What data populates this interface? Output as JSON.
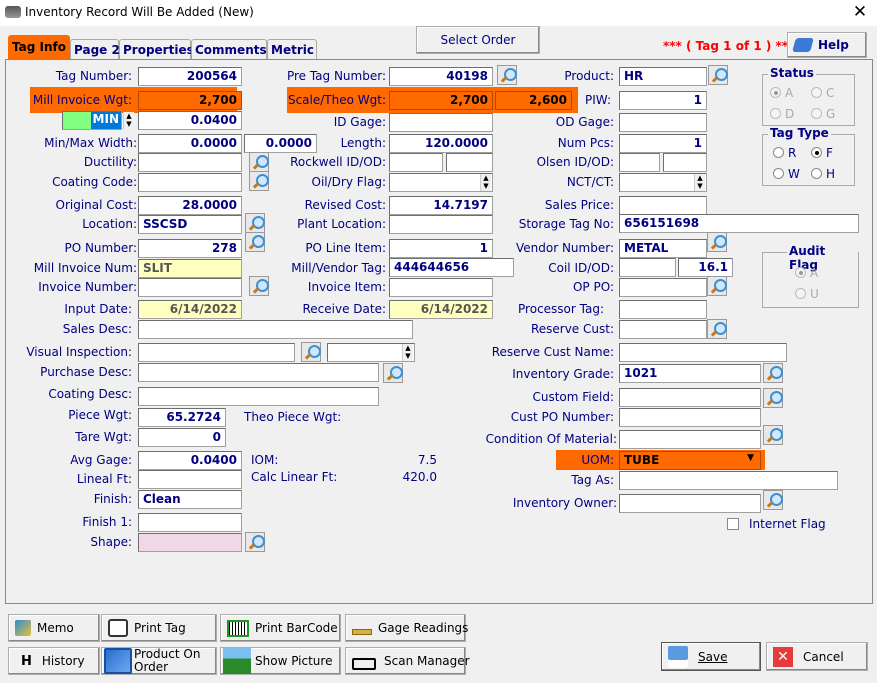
{
  "window": {
    "title": "Inventory Record Will Be Added  (New)",
    "close": "✕"
  },
  "tabs": [
    {
      "label": "Tag Info"
    },
    {
      "label": "Page 2"
    },
    {
      "label": "Properties"
    },
    {
      "label": "Comments"
    },
    {
      "label": "Metric"
    }
  ],
  "header": {
    "select_order": "Select Order",
    "tag_counter": "***   ( Tag 1 of 1 )   ***",
    "help": "Help"
  },
  "fields": {
    "tag_number": {
      "label": "Tag Number:",
      "value": "200564"
    },
    "mill_invoice_wgt": {
      "label": "Mill Invoice Wgt:",
      "value": "2,700"
    },
    "unit_select": {
      "value": "MIN"
    },
    "gage": {
      "value": "0.0400"
    },
    "min_max_width": {
      "label": "Min/Max Width:",
      "min": "0.0000",
      "max": "0.0000"
    },
    "ductility": {
      "label": "Ductility:",
      "value": ""
    },
    "coating_code": {
      "label": "Coating Code:",
      "value": ""
    },
    "original_cost": {
      "label": "Original Cost:",
      "value": "28.0000"
    },
    "location": {
      "label": "Location:",
      "value": "SSCSD"
    },
    "po_number": {
      "label": "PO Number:",
      "value": "278"
    },
    "mill_invoice_num": {
      "label": "Mill Invoice Num:",
      "value": "SLIT"
    },
    "invoice_number": {
      "label": "Invoice Number:",
      "value": ""
    },
    "input_date": {
      "label": "Input Date:",
      "value": "6/14/2022"
    },
    "sales_desc": {
      "label": "Sales Desc:",
      "value": ""
    },
    "visual_inspection": {
      "label": "Visual Inspection:",
      "value": "",
      "value2": ""
    },
    "purchase_desc": {
      "label": "Purchase Desc:",
      "value": ""
    },
    "coating_desc": {
      "label": "Coating Desc:",
      "value": ""
    },
    "piece_wgt": {
      "label": "Piece Wgt:",
      "value": "65.2724"
    },
    "theo_piece_wgt": {
      "label": "Theo Piece Wgt:"
    },
    "tare_wgt": {
      "label": "Tare Wgt:",
      "value": "0"
    },
    "avg_gage": {
      "label": "Avg Gage:",
      "value": "0.0400"
    },
    "lineal_ft": {
      "label": "Lineal Ft:",
      "value": ""
    },
    "finish": {
      "label": "Finish:",
      "value": "Clean"
    },
    "finish1": {
      "label": "Finish 1:",
      "value": ""
    },
    "shape": {
      "label": "Shape:",
      "value": ""
    },
    "iom": {
      "label": "IOM:",
      "value": "7.5"
    },
    "calc_linear_ft": {
      "label": "Calc Linear Ft:",
      "value": "420.0"
    },
    "pre_tag_number": {
      "label": "Pre Tag Number:",
      "value": "40198"
    },
    "scale_theo_wgt": {
      "label": "Scale/Theo Wgt:",
      "scale": "2,700",
      "theo": "2,600"
    },
    "id_gage": {
      "label": "ID Gage:",
      "value": ""
    },
    "length": {
      "label": "Length:",
      "value": "120.0000"
    },
    "rockwell": {
      "label": "Rockwell ID/OD:",
      "id": "",
      "od": ""
    },
    "oil_dry_flag": {
      "label": "Oil/Dry Flag:",
      "value": ""
    },
    "revised_cost": {
      "label": "Revised Cost:",
      "value": "14.7197"
    },
    "plant_location": {
      "label": "Plant Location:",
      "value": ""
    },
    "po_line_item": {
      "label": "PO Line Item:",
      "value": "1"
    },
    "mill_vendor_tag": {
      "label": "Mill/Vendor Tag:",
      "value": "444644656"
    },
    "invoice_item": {
      "label": "Invoice Item:",
      "value": ""
    },
    "receive_date": {
      "label": "Receive Date:",
      "value": "6/14/2022"
    },
    "product": {
      "label": "Product:",
      "value": "HR"
    },
    "piw": {
      "label": "PIW:",
      "value": "1"
    },
    "od_gage": {
      "label": "OD Gage:",
      "value": ""
    },
    "num_pcs": {
      "label": "Num Pcs:",
      "value": "1"
    },
    "olsen": {
      "label": "Olsen ID/OD:",
      "id": "",
      "od": ""
    },
    "nct_ct": {
      "label": "NCT/CT:",
      "value": ""
    },
    "sales_price": {
      "label": "Sales Price:",
      "value": ""
    },
    "storage_tag_no": {
      "label": "Storage Tag No:",
      "value": "656151698"
    },
    "vendor_number": {
      "label": "Vendor Number:",
      "value": "METAL"
    },
    "coil_id_od": {
      "label": "Coil ID/OD:",
      "id": "",
      "od": "16.1"
    },
    "op_po": {
      "label": "OP PO:",
      "value": ""
    },
    "processor_tag": {
      "label": "Processor Tag:",
      "value": ""
    },
    "reserve_cust": {
      "label": "Reserve Cust:",
      "value": ""
    },
    "reserve_cust_name": {
      "label": "Reserve Cust Name:",
      "value": ""
    },
    "inventory_grade": {
      "label": "Inventory Grade:",
      "value": "1021"
    },
    "custom_field": {
      "label": "Custom Field:",
      "value": ""
    },
    "cust_po_number": {
      "label": "Cust PO Number:",
      "value": ""
    },
    "condition_of_material": {
      "label": "Condition Of Material:",
      "value": ""
    },
    "uom": {
      "label": "UOM:",
      "value": "TUBE"
    },
    "tag_as": {
      "label": "Tag As:",
      "value": ""
    },
    "inventory_owner": {
      "label": "Inventory Owner:",
      "value": ""
    },
    "internet_flag": {
      "label": "Internet Flag",
      "checked": false
    }
  },
  "status": {
    "title": "Status",
    "options": [
      "A",
      "C",
      "D",
      "G"
    ],
    "selected": "A"
  },
  "tag_type": {
    "title": "Tag Type",
    "options": [
      "R",
      "F",
      "W",
      "H"
    ],
    "selected": "F"
  },
  "audit_flag": {
    "title": "Audit Flag",
    "options": [
      "A",
      "U"
    ],
    "selected": "A"
  },
  "buttons": {
    "memo": "Memo",
    "print_tag": "Print Tag",
    "print_barcode": "Print BarCode",
    "gage_readings": "Gage Readings",
    "history": "History",
    "history_key": "H",
    "product_on_order": "Product On Order",
    "show_picture": "Show Picture",
    "scan_manager": "Scan Manager",
    "save": "Save",
    "cancel": "Cancel"
  },
  "colors": {
    "highlight": "#ff6a00",
    "label": "#000080",
    "readonly_yellow": "#ffffc0",
    "shape_pink": "#f0d8e8",
    "counter_red": "#ff0000"
  }
}
